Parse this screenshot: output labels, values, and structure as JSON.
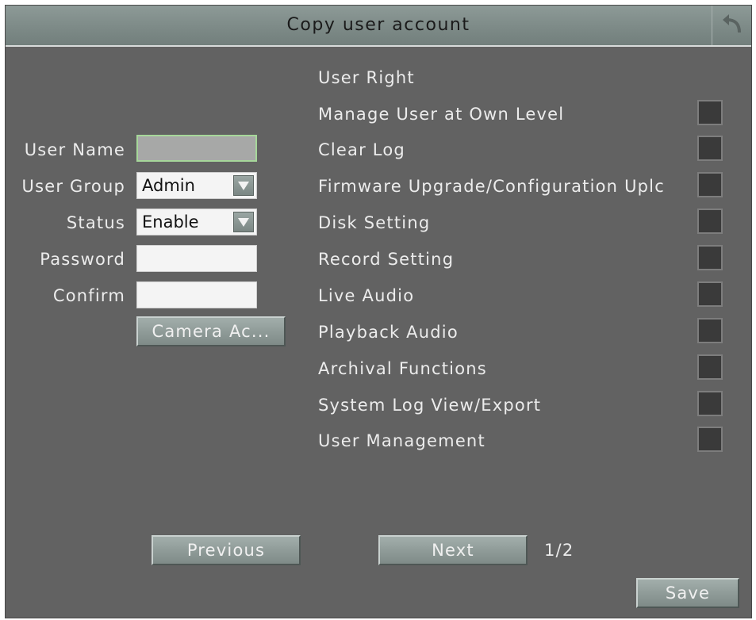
{
  "window": {
    "title": "Copy user account",
    "back_icon": "back-arrow-icon"
  },
  "form": {
    "user_name_label": "User Name",
    "user_name_value": "",
    "user_group_label": "User Group",
    "user_group_value": "Admin",
    "status_label": "Status",
    "status_value": "Enable",
    "password_label": "Password",
    "password_value": "",
    "confirm_label": "Confirm",
    "confirm_value": "",
    "camera_access_label": "Camera Ac..."
  },
  "rights": {
    "header": "User Right",
    "items": [
      {
        "label": "Manage User at Own Level",
        "checked": false
      },
      {
        "label": "Clear Log",
        "checked": false
      },
      {
        "label": "Firmware Upgrade/Configuration Uplc",
        "checked": false
      },
      {
        "label": "Disk Setting",
        "checked": false
      },
      {
        "label": "Record Setting",
        "checked": false
      },
      {
        "label": "Live Audio",
        "checked": false
      },
      {
        "label": "Playback Audio",
        "checked": false
      },
      {
        "label": "Archival Functions",
        "checked": false
      },
      {
        "label": "System Log View/Export",
        "checked": false
      },
      {
        "label": "User Management",
        "checked": false
      }
    ]
  },
  "footer": {
    "previous_label": "Previous",
    "next_label": "Next",
    "page_indicator": "1/2",
    "save_label": "Save"
  }
}
